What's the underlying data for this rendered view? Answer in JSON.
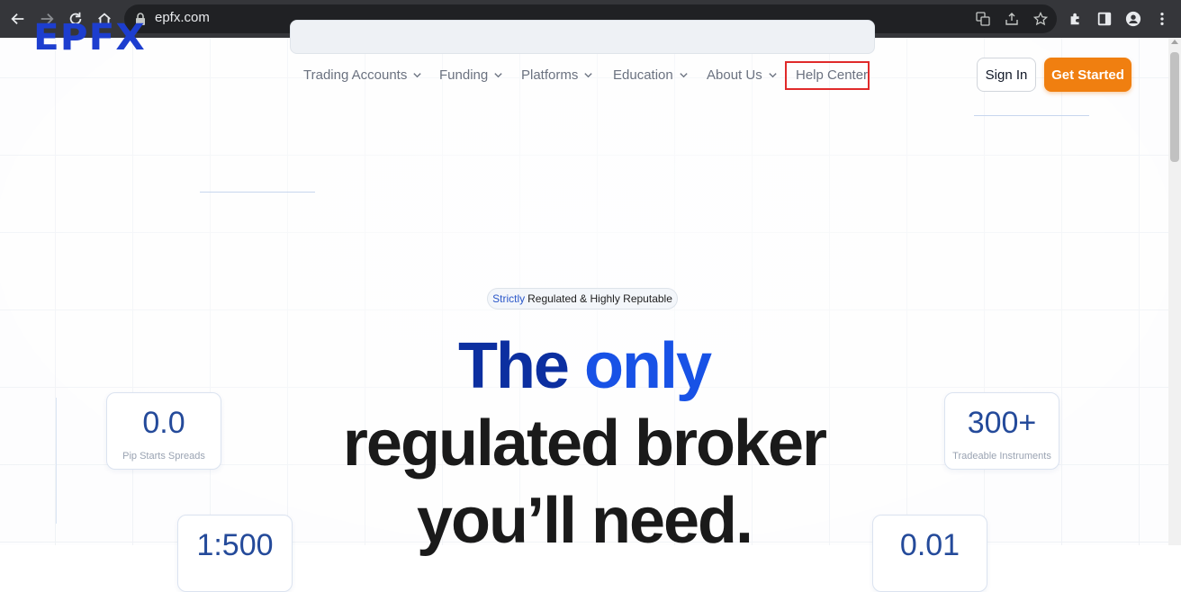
{
  "browser": {
    "url": "epfx.com"
  },
  "header": {
    "logo_text": "EPFX",
    "nav": [
      {
        "label": "Trading Accounts"
      },
      {
        "label": "Funding"
      },
      {
        "label": "Platforms"
      },
      {
        "label": "Education"
      },
      {
        "label": "About Us"
      }
    ],
    "help_center": "Help Center",
    "sign_in": "Sign In",
    "get_started": "Get Started"
  },
  "hero": {
    "badge_highlight": "Strictly",
    "badge_rest": "Regulated & Highly Reputable",
    "headline_the": "The",
    "headline_only": "only",
    "headline_line2": "regulated broker",
    "headline_line3": "you’ll need."
  },
  "stats": [
    {
      "value": "0.0",
      "label": "Pip Starts Spreads"
    },
    {
      "value": "300+",
      "label": "Tradeable Instruments"
    },
    {
      "value": "1:500",
      "label": ""
    },
    {
      "value": "0.01",
      "label": ""
    }
  ],
  "colors": {
    "brand_blue": "#1d3ecf",
    "accent_orange": "#f07f10",
    "highlight_box": "#e02a2a"
  }
}
